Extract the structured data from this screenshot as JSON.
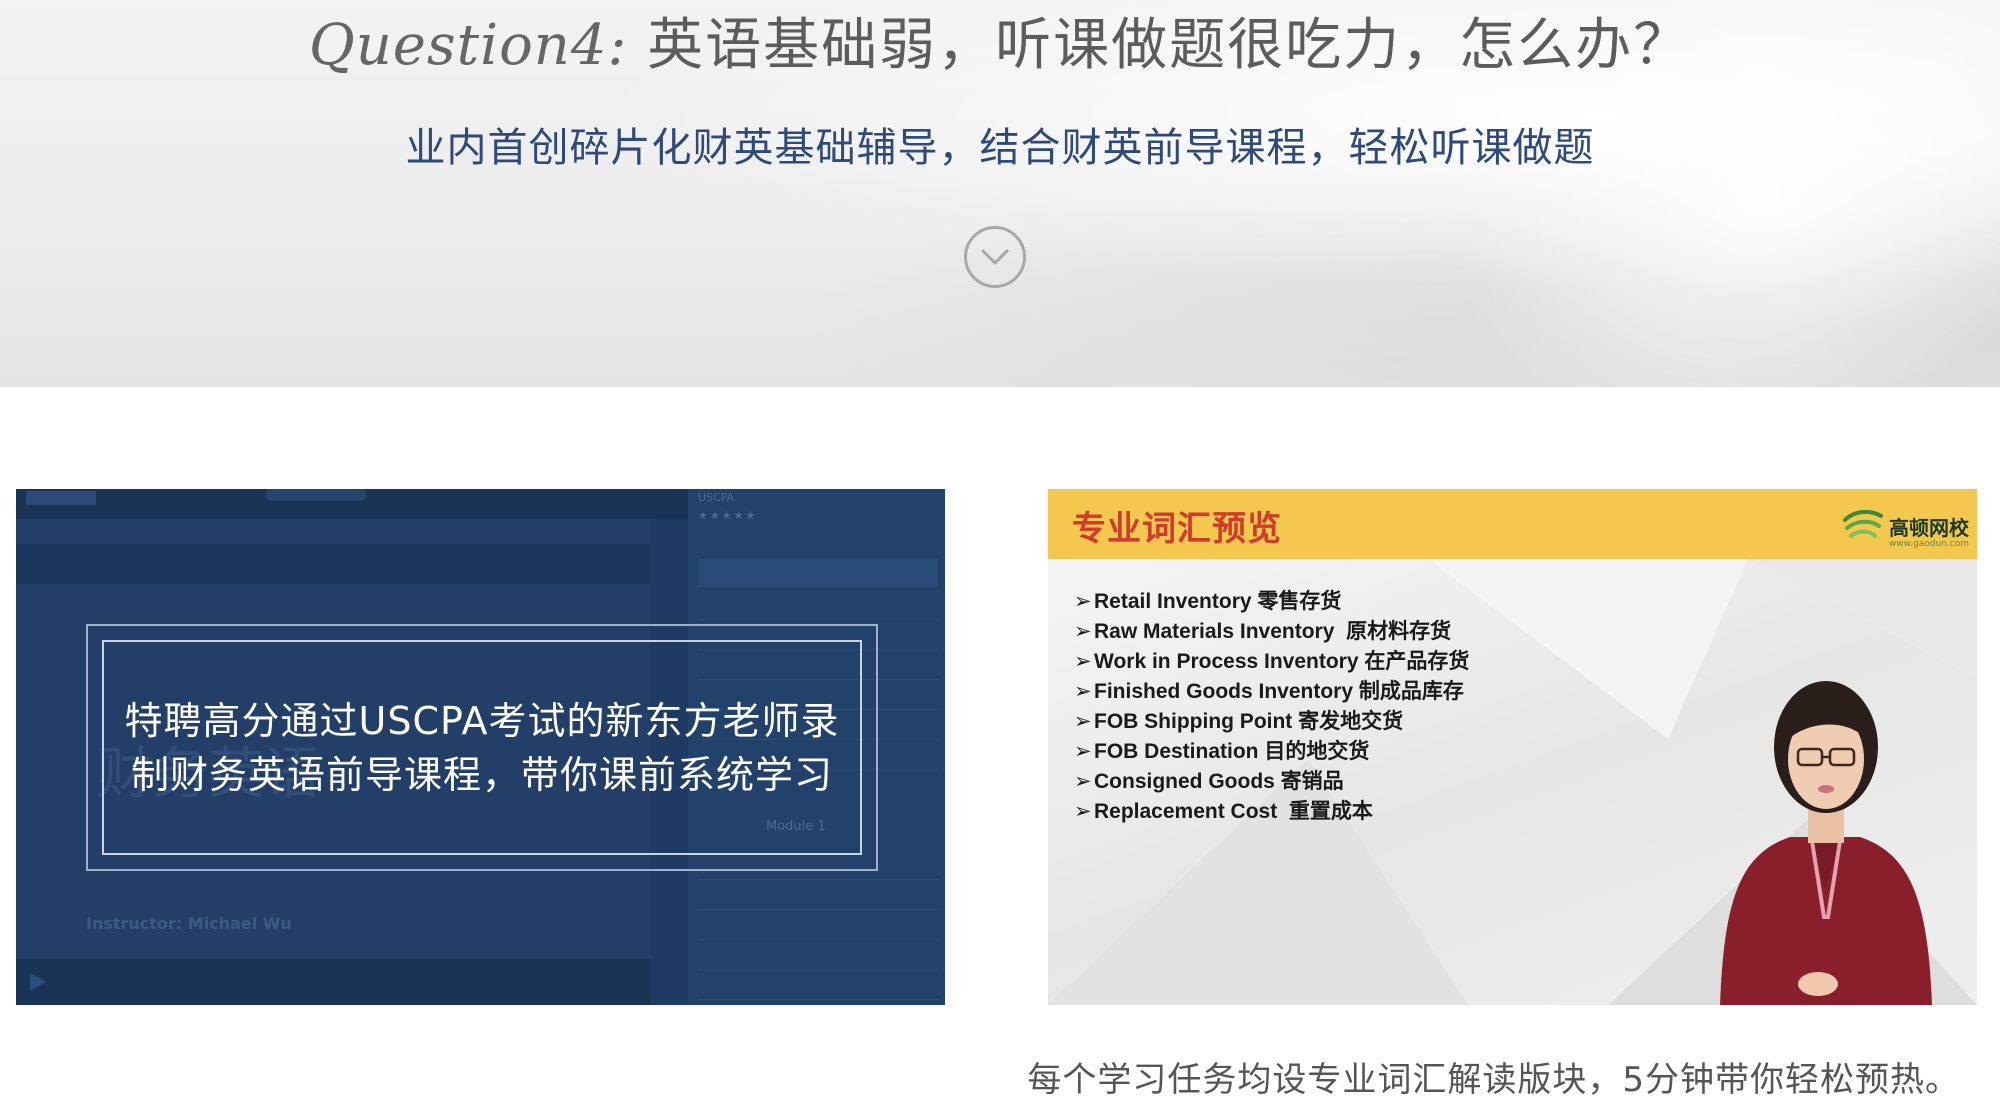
{
  "banner": {
    "question_prefix": "Question4:",
    "question_text": "英语基础弱，听课做题很吃力，怎么办？",
    "subtitle": "业内首创碎片化财英基础辅导，结合财英前导课程，轻松听课做题",
    "scroll_icon": "chevron-down-circle-icon"
  },
  "left_card": {
    "overlay_text": "特聘高分通过USCPA考试的新东方老师录制财务英语前导课程，带你课前系统学习",
    "background": {
      "ghost_title": "财务英语",
      "instructor": "Instructor: Michael Wu",
      "side_title": "USCPA",
      "module_label": "Module 1"
    }
  },
  "right_card": {
    "header_title": "专业词汇预览",
    "logo_name": "高顿网校",
    "logo_url": "www.gaodun.com",
    "vocab": [
      {
        "en": "Retail Inventory",
        "zh": "零售存货"
      },
      {
        "en": "Raw Materials Inventory",
        "zh": "原材料存货"
      },
      {
        "en": "Work in Process Inventory",
        "zh": "在产品存货"
      },
      {
        "en": "Finished Goods Inventory",
        "zh": "制成品库存"
      },
      {
        "en": "FOB Shipping Point",
        "zh": "寄发地交货"
      },
      {
        "en": "FOB Destination",
        "zh": "目的地交货"
      },
      {
        "en": "Consigned Goods",
        "zh": "寄销品"
      },
      {
        "en": "Replacement Cost",
        "zh": "重置成本"
      }
    ],
    "bullet_glyph": "➢"
  },
  "caption": "每个学习任务均设专业词汇解读版块，5分钟带你轻松预热。",
  "colors": {
    "banner_bg": "#ececec",
    "subtitle": "#2e4a7a",
    "left_card_bg": "#1f3b63",
    "right_header": "#f4c84e",
    "right_title": "#d13a2c"
  }
}
